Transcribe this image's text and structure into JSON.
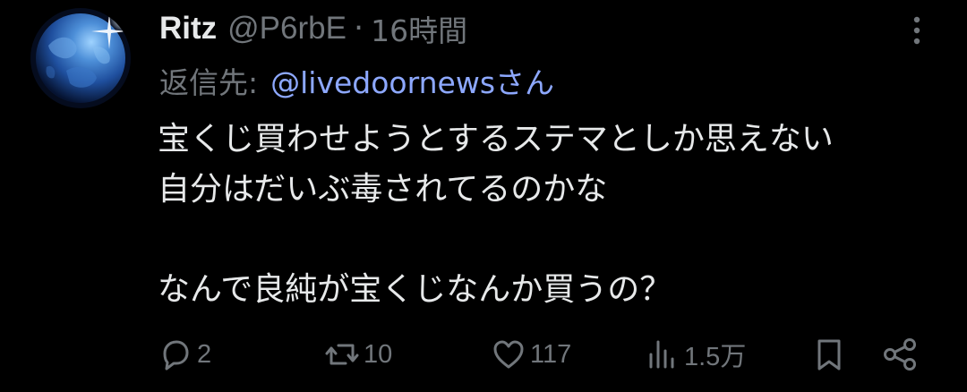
{
  "post": {
    "author_name": "Ritz",
    "handle": "@P6rbE",
    "separator": "·",
    "time": "16時間",
    "reply_label": "返信先:",
    "reply_mention": "@livedoornewsさん",
    "body_lines": [
      "宝くじ買わせようとするステマとしか思えない",
      "自分はだいぶ毒されてるのかな",
      "",
      "なんで良純が宝くじなんか買うの？"
    ]
  },
  "actions": {
    "reply": {
      "icon": "reply-icon",
      "count": "2"
    },
    "repost": {
      "icon": "repost-icon",
      "count": "10"
    },
    "like": {
      "icon": "heart-icon",
      "count": "117"
    },
    "views": {
      "icon": "views-icon",
      "count": "1.5万"
    },
    "bookmark": {
      "icon": "bookmark-icon"
    },
    "share": {
      "icon": "share-icon"
    }
  },
  "colors": {
    "background": "#000000",
    "primary_text": "#e7e9ea",
    "secondary_text": "#71767b",
    "mention": "#8da8ff"
  }
}
